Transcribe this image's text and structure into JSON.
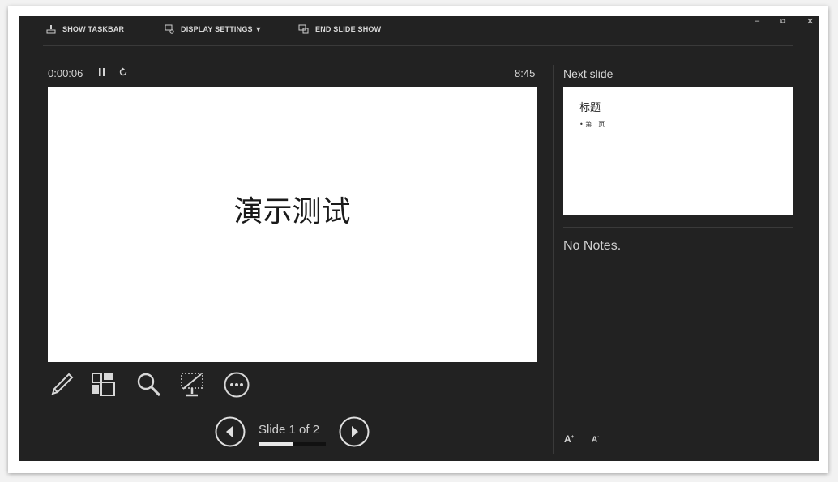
{
  "toolbar": {
    "show_taskbar": "SHOW TASKBAR",
    "display_settings": "DISPLAY SETTINGS ▼",
    "end_slide_show": "END SLIDE SHOW"
  },
  "window_controls": {
    "minimize": "–",
    "restore": "⧉",
    "close": "✕"
  },
  "presenter": {
    "elapsed_time": "0:00:06",
    "clock": "8:45",
    "current_slide_title": "演示测试",
    "slide_counter": "Slide 1 of 2",
    "progress_fraction": 0.5
  },
  "next_slide": {
    "label": "Next slide",
    "title": "标题",
    "bullet": "• 第二页"
  },
  "notes": {
    "text": "No Notes."
  },
  "font_controls": {
    "increase": "A",
    "decrease": "A"
  },
  "icons": {
    "taskbar": "taskbar-icon",
    "display": "display-settings-icon",
    "end": "end-show-icon",
    "pause": "pause-icon",
    "reset": "reset-icon",
    "pen": "pen-icon",
    "slides": "see-all-slides-icon",
    "zoom": "zoom-icon",
    "black": "black-screen-icon",
    "more": "more-options-icon",
    "prev": "previous-arrow-icon",
    "next": "next-arrow-icon"
  },
  "colors": {
    "background": "#222222",
    "foreground": "#cfcfcf",
    "slide": "#ffffff"
  }
}
